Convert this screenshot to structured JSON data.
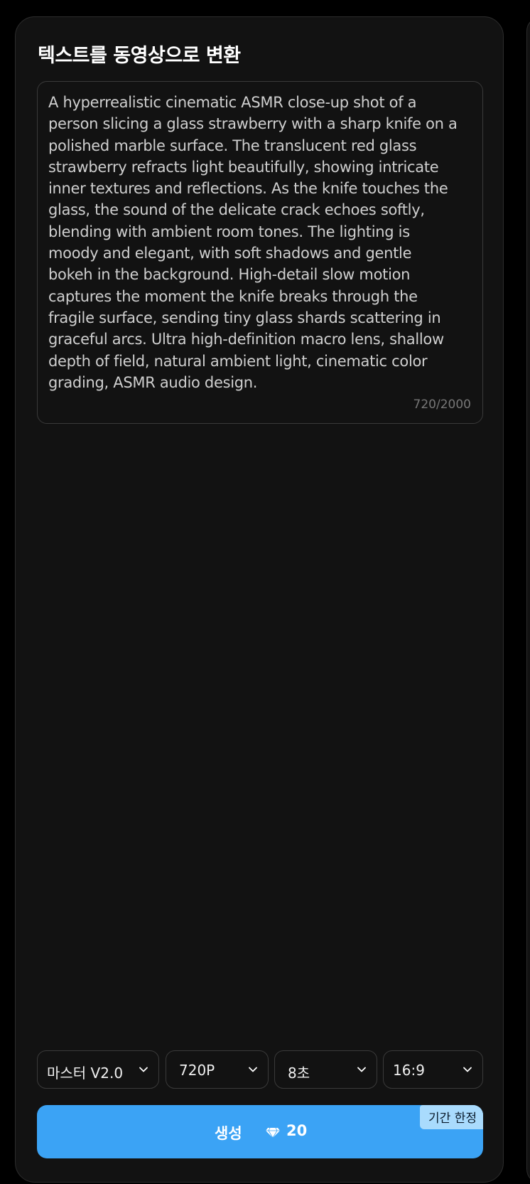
{
  "panel": {
    "title": "텍스트를 동영상으로 변환"
  },
  "prompt": {
    "text": "A hyperrealistic cinematic ASMR close-up shot of a\nperson slicing a glass strawberry with a sharp knife on a\npolished marble surface. The translucent red glass\nstrawberry refracts light beautifully, showing intricate\ninner textures and reflections. As the knife touches the\nglass, the sound of the delicate crack echoes softly,\nblending with ambient room tones. The lighting is\nmoody and elegant, with soft shadows and gentle\nbokeh in the background. High-detail slow motion\ncaptures the moment the knife breaks through the\nfragile surface, sending tiny glass shards scattering in\ngraceful arcs. Ultra high-definition macro lens, shallow\ndepth of field, natural ambient light, cinematic color\ngrading, ASMR audio design.",
    "counter": "720/2000"
  },
  "options": {
    "model": "마스터 V2.0",
    "resolution": "720P",
    "duration": "8초",
    "aspect": "16:9"
  },
  "generate": {
    "label": "생성",
    "cost": "20",
    "badge": "기간 한정",
    "color": "#3ba3f5",
    "icon": "diamond-icon"
  }
}
